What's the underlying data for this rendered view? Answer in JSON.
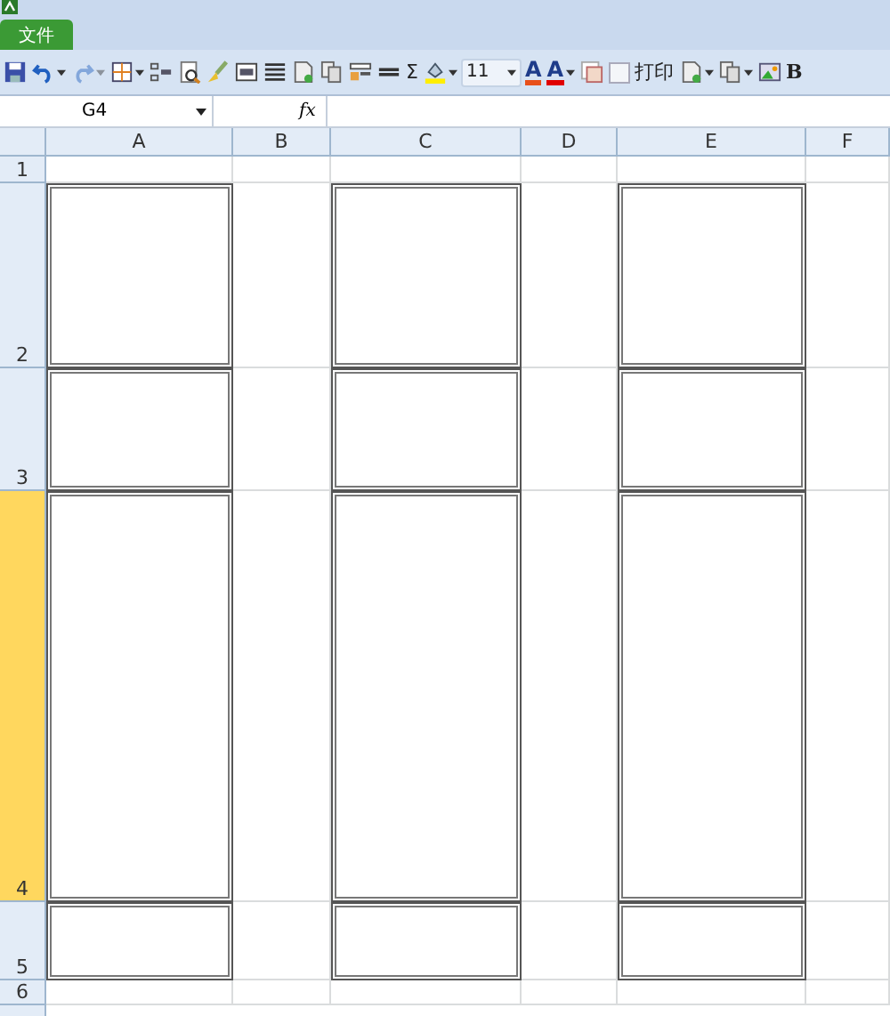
{
  "file_tab": {
    "label": "文件",
    "selected": true
  },
  "toolbar": [
    {
      "kind": "save",
      "dropdown": false,
      "disabled": false
    },
    {
      "kind": "undo",
      "dropdown": true,
      "disabled": false
    },
    {
      "kind": "redo",
      "dropdown": true,
      "disabled": true
    },
    {
      "kind": "borders",
      "dropdown": true,
      "disabled": false
    },
    {
      "kind": "merge",
      "dropdown": false,
      "disabled": false
    },
    {
      "kind": "preview",
      "dropdown": false,
      "disabled": false
    },
    {
      "kind": "brush",
      "dropdown": false,
      "disabled": false
    },
    {
      "kind": "wrap",
      "dropdown": false,
      "disabled": false
    },
    {
      "kind": "lines",
      "dropdown": false,
      "disabled": false
    },
    {
      "kind": "page",
      "dropdown": false,
      "disabled": false
    },
    {
      "kind": "copy",
      "dropdown": false,
      "disabled": false
    },
    {
      "kind": "layout",
      "dropdown": false,
      "disabled": false
    },
    {
      "kind": "equal",
      "dropdown": false,
      "disabled": false
    },
    {
      "kind": "text",
      "text": "Σ",
      "dropdown": false,
      "disabled": false
    },
    {
      "kind": "fill",
      "dropdown": true,
      "disabled": false
    },
    {
      "kind": "field",
      "value": "11",
      "dropdown": true,
      "disabled": false
    },
    {
      "kind": "letter",
      "text": "A",
      "color": "#e8501a",
      "dropdown": false,
      "disabled": false
    },
    {
      "kind": "letter",
      "text": "A",
      "color": "#e00000",
      "dropdown": true,
      "disabled": false
    },
    {
      "kind": "table",
      "dropdown": false,
      "disabled": false
    },
    {
      "kind": "checkbox",
      "checked": false,
      "dropdown": false,
      "disabled": false
    },
    {
      "kind": "text",
      "text": "打印",
      "dropdown": false,
      "disabled": false
    },
    {
      "kind": "page",
      "dropdown": true,
      "disabled": false
    },
    {
      "kind": "copy",
      "dropdown": true,
      "disabled": false
    },
    {
      "kind": "picture-tool",
      "dropdown": false,
      "disabled": false
    },
    {
      "kind": "bold",
      "text": "B",
      "dropdown": false,
      "disabled": false
    }
  ],
  "name_box": {
    "value": "G4"
  },
  "formula_bar": {
    "fx": "fx"
  },
  "columns": [
    {
      "label": "A",
      "selected": false
    },
    {
      "label": "B",
      "selected": false
    },
    {
      "label": "C",
      "selected": false
    },
    {
      "label": "D",
      "selected": false
    },
    {
      "label": "E",
      "selected": false
    },
    {
      "label": "F",
      "selected": false
    }
  ],
  "rows": [
    {
      "label": "1",
      "selected": false,
      "bordered": [
        false,
        false,
        false,
        false,
        false,
        false
      ]
    },
    {
      "label": "2",
      "selected": false,
      "bordered": [
        true,
        false,
        true,
        false,
        true,
        false
      ]
    },
    {
      "label": "3",
      "selected": false,
      "bordered": [
        true,
        false,
        true,
        false,
        true,
        false
      ]
    },
    {
      "label": "4",
      "selected": true,
      "bordered": [
        true,
        false,
        true,
        false,
        true,
        false
      ]
    },
    {
      "label": "5",
      "selected": false,
      "bordered": [
        true,
        false,
        true,
        false,
        true,
        false
      ]
    },
    {
      "label": "6",
      "selected": false,
      "bordered": [
        false,
        false,
        false,
        false,
        false,
        false
      ]
    }
  ]
}
